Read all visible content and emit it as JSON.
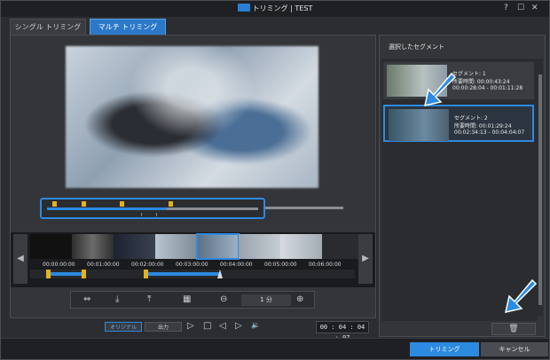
{
  "window": {
    "title": "トリミング | TEST",
    "help": "?",
    "minimize": "☐",
    "close": "✕"
  },
  "tabs": [
    {
      "label": "シングル トリミング",
      "active": false
    },
    {
      "label": "マルチ トリミング",
      "active": true
    }
  ],
  "player": {
    "timecodes": [
      "00:00:00:00",
      "00:01:00:00",
      "00:02:00:00",
      "00:03:00:00",
      "00:04:00:00",
      "00:05:00:00",
      "00:06:00:00"
    ],
    "zoom_label": "1 分",
    "view_modes": [
      "オリジナル",
      "出力"
    ],
    "current_time": "00 : 04 : 04 : 07",
    "playback": {
      "progress": 0.73
    }
  },
  "icons": {
    "nav_prev": "◀",
    "nav_next": "▶",
    "zoom_out": "⊖",
    "zoom_in": "⊕",
    "play": "▷",
    "stop": "□",
    "prev_frame": "◁",
    "next_frame": "▷",
    "volume": "🔉",
    "trash": "🗑"
  },
  "segments_panel": {
    "title": "選択したセグメント",
    "segments": [
      {
        "name": "セグメント: 1",
        "duration": "所要時間: 00:00:43:24",
        "range": "00:00:28:04 - 00:01:11:28",
        "selected": false
      },
      {
        "name": "セグメント: 2",
        "duration": "所要時間: 00:01:29:24",
        "range": "00:02:34:13 - 00:04:04:07",
        "selected": true
      }
    ]
  },
  "footer": {
    "trim_label": "トリミング",
    "cancel_label": "キャンセル"
  },
  "colors": {
    "accent": "#2c8ae0",
    "marker": "#e3b21f"
  }
}
